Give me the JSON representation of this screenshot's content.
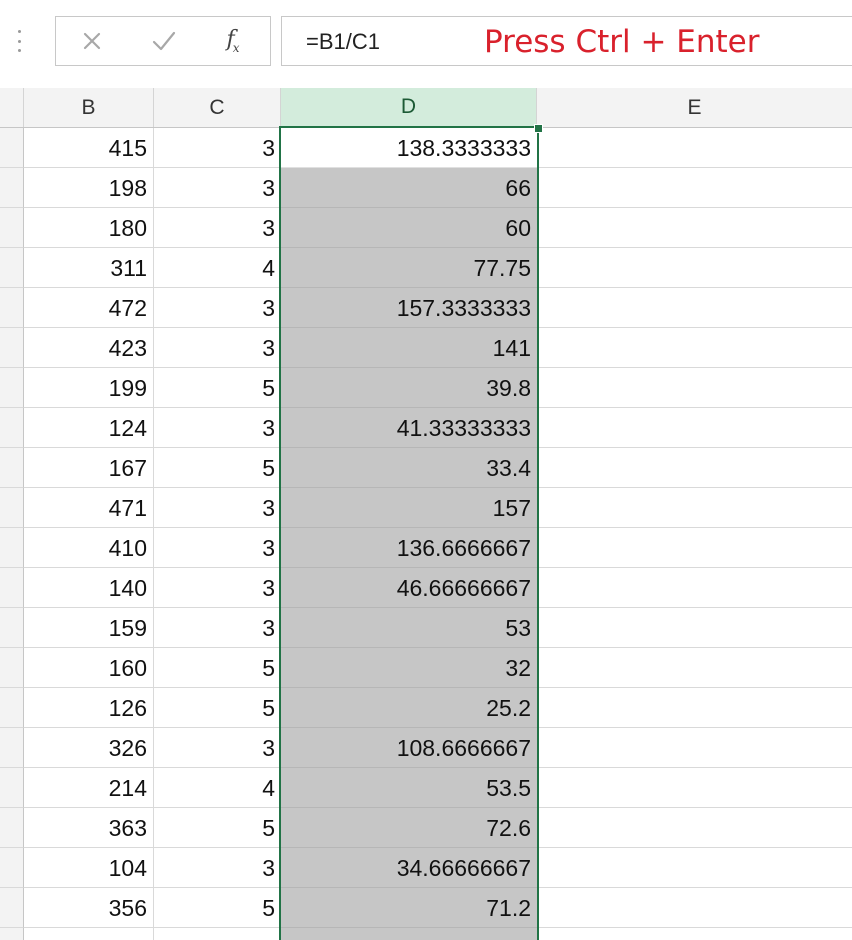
{
  "formula_bar": {
    "cancel_icon": "close-x-icon",
    "enter_icon": "check-icon",
    "fx_label": "fx",
    "formula": "=B1/C1",
    "annotation": "Press Ctrl + Enter",
    "annotation_color": "#d9212c"
  },
  "columns": {
    "b": "B",
    "c": "C",
    "d": "D",
    "e": "E"
  },
  "selection_color": "#217346",
  "selected_fill": "#c6c6c6",
  "rows": [
    {
      "b": "415",
      "c": "3",
      "d": "138.3333333"
    },
    {
      "b": "198",
      "c": "3",
      "d": "66"
    },
    {
      "b": "180",
      "c": "3",
      "d": "60"
    },
    {
      "b": "311",
      "c": "4",
      "d": "77.75"
    },
    {
      "b": "472",
      "c": "3",
      "d": "157.3333333"
    },
    {
      "b": "423",
      "c": "3",
      "d": "141"
    },
    {
      "b": "199",
      "c": "5",
      "d": "39.8"
    },
    {
      "b": "124",
      "c": "3",
      "d": "41.33333333"
    },
    {
      "b": "167",
      "c": "5",
      "d": "33.4"
    },
    {
      "b": "471",
      "c": "3",
      "d": "157"
    },
    {
      "b": "410",
      "c": "3",
      "d": "136.6666667"
    },
    {
      "b": "140",
      "c": "3",
      "d": "46.66666667"
    },
    {
      "b": "159",
      "c": "3",
      "d": "53"
    },
    {
      "b": "160",
      "c": "5",
      "d": "32"
    },
    {
      "b": "126",
      "c": "5",
      "d": "25.2"
    },
    {
      "b": "326",
      "c": "3",
      "d": "108.6666667"
    },
    {
      "b": "214",
      "c": "4",
      "d": "53.5"
    },
    {
      "b": "363",
      "c": "5",
      "d": "72.6"
    },
    {
      "b": "104",
      "c": "3",
      "d": "34.66666667"
    },
    {
      "b": "356",
      "c": "5",
      "d": "71.2"
    },
    {
      "b": "",
      "c": "",
      "d": ""
    }
  ]
}
